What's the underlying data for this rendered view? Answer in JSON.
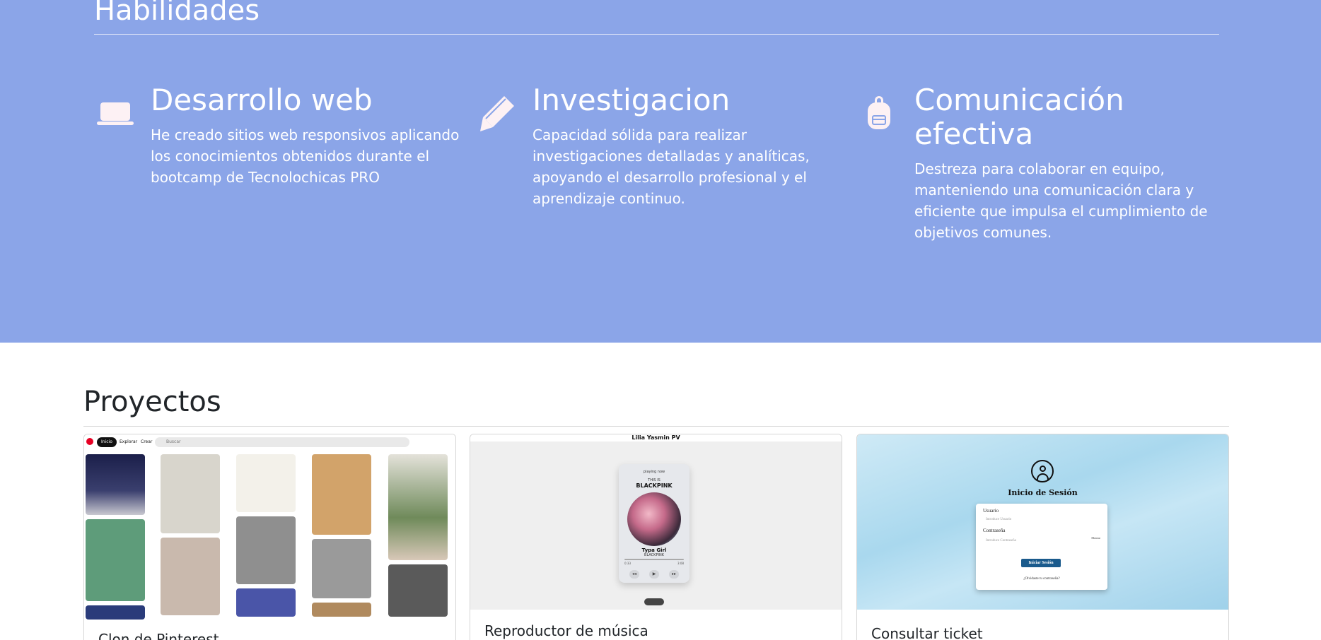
{
  "skills": {
    "title": "Habilidades",
    "items": [
      {
        "icon": "laptop-icon",
        "title": "Desarrollo web",
        "text": "He creado sitios web responsivos aplicando los conocimientos obtenidos durante el bootcamp de Tecnolochicas PRO"
      },
      {
        "icon": "pencil-icon",
        "title": "Investigacion",
        "text": "Capacidad sólida para realizar investigaciones detalladas y analíticas, apoyando el desarrollo profesional y el aprendizaje continuo."
      },
      {
        "icon": "backpack-icon",
        "title": "Comunicación efectiva",
        "text": "Destreza para colaborar en equipo, manteniendo una comunicación clara y eficiente que impulsa el cumplimiento de objetivos comunes."
      }
    ]
  },
  "projects": {
    "title": "Proyectos",
    "cards": [
      {
        "title": "Clon de Pinterest",
        "thumb": {
          "nav_inicio": "Inicio",
          "nav_explorar": "Explorar",
          "nav_crear": "Crear",
          "search_placeholder": "Buscar"
        }
      },
      {
        "title": "Reproductor de música",
        "thumb": {
          "header": "Lilia Yasmin PV",
          "playing_now": "playing now",
          "this_is": "THIS IS",
          "band": "BLACKPINK",
          "song": "Typa Girl",
          "artist": "BLACKPINK",
          "time_start": "0:33",
          "time_end": "3:08"
        }
      },
      {
        "title": "Consultar ticket",
        "thumb": {
          "heading": "Inicio de Sesión",
          "user_label": "Usuario",
          "user_placeholder": "Introduce Usuario",
          "password_label": "Contraseña",
          "password_placeholder": "Introduce Contraseña",
          "show_label": "Mostrar",
          "button": "Iniciar Sesión",
          "forgot": "¿Olvidaste tu contraseña?"
        }
      }
    ]
  },
  "colors": {
    "skills_background": "#8ba5e8",
    "skills_text": "#ffffff",
    "icon_fill": "#fdf1f4"
  }
}
